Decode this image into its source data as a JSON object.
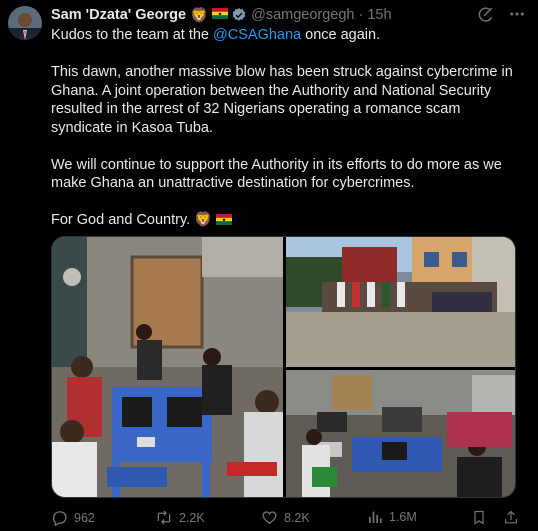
{
  "author": {
    "name": "Sam 'Dzata' George",
    "name_emoji": "🦁 ",
    "handle": "@samgeorgegh",
    "separator": "·",
    "time": "15h"
  },
  "text": {
    "line1_prefix": "Kudos to the team at the ",
    "mention": "@CSAGhana",
    "line1_suffix": " once again.",
    "para2": "This dawn, another massive blow has been struck against cybercrime in Ghana. A joint operation between the Authority and National Security resulted in the arrest of 32 Nigerians operating a romance scam syndicate in Kasoa Tuba.",
    "para3": "We will continue to support the Authority in its efforts to do more as we make Ghana an unattractive destination for cybercrimes.",
    "para4": "For God and Country. 🦁 "
  },
  "metrics": {
    "replies": "962",
    "reposts": "2.2K",
    "likes": "8.2K",
    "views": "1.6M"
  },
  "colors": {
    "accent": "#1d9bf0",
    "muted": "#71767b",
    "text": "#e7e9ea",
    "background": "#000000"
  },
  "icons": {
    "verified": "verified-badge-icon",
    "grok": "grok-icon",
    "more": "more-icon",
    "reply": "reply-icon",
    "repost": "repost-icon",
    "like": "like-icon",
    "views": "views-icon",
    "bookmark": "bookmark-icon",
    "share": "share-icon"
  }
}
